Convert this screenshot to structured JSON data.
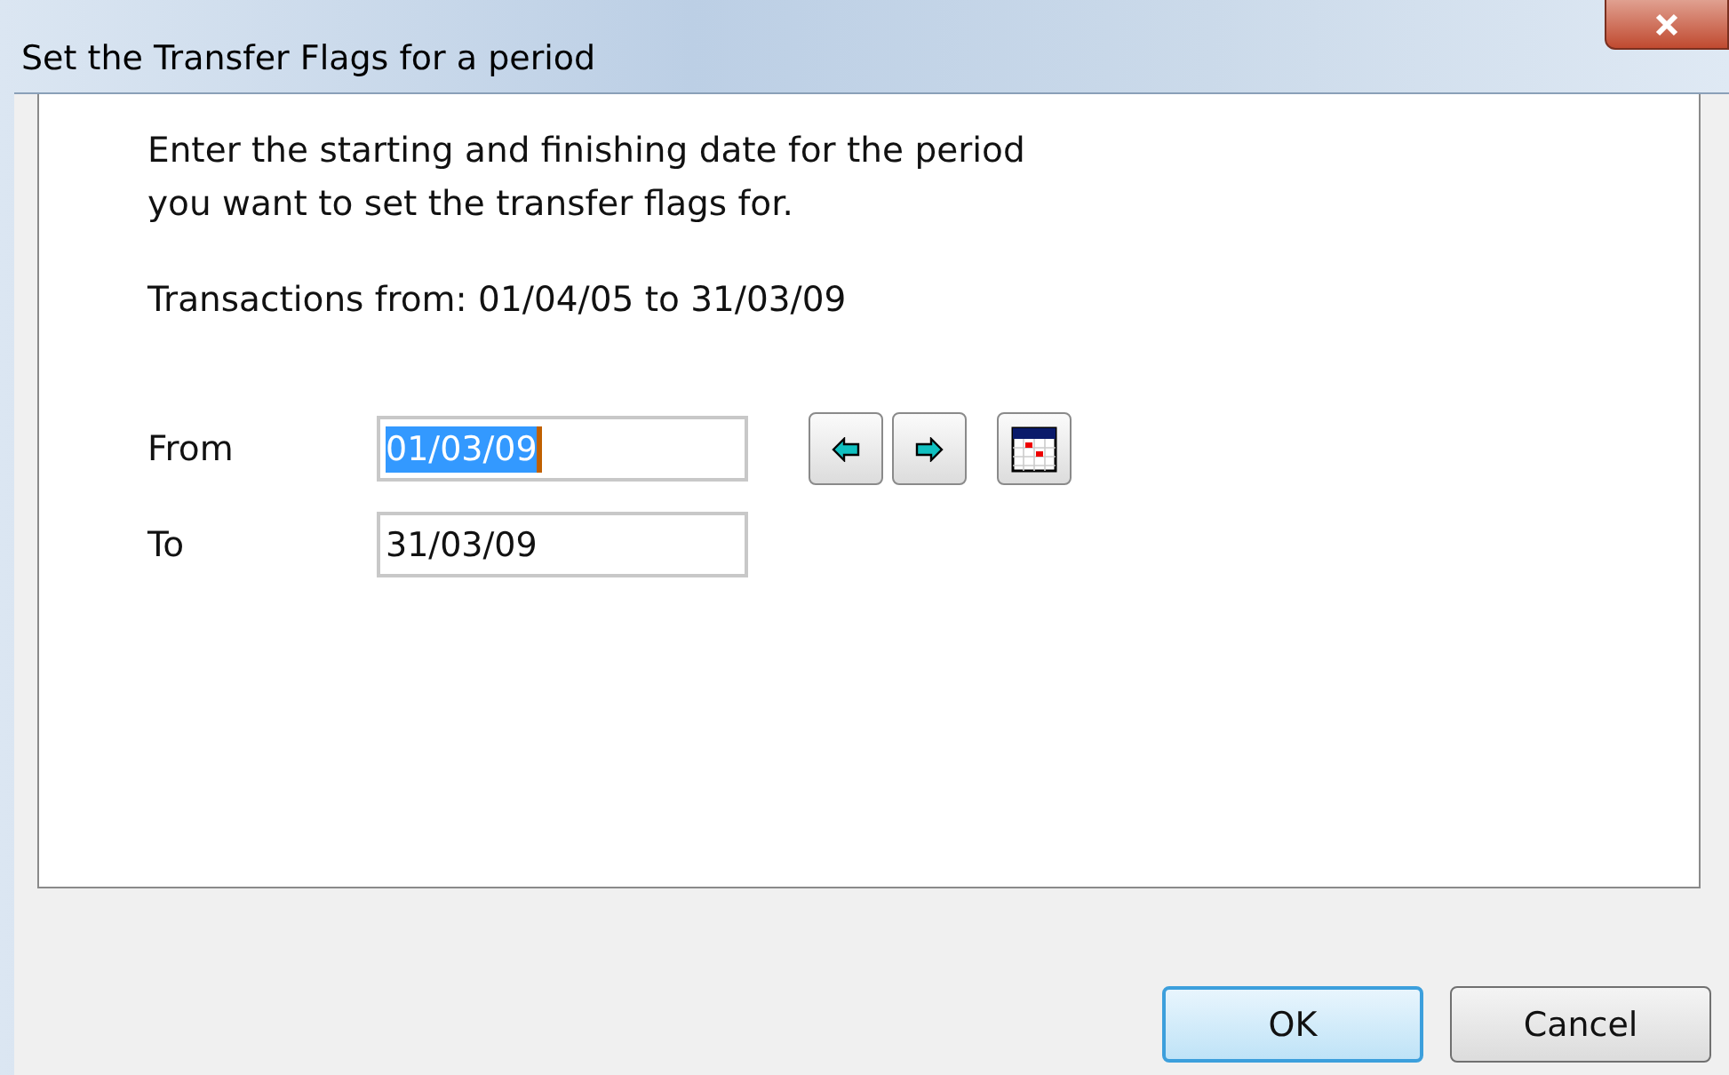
{
  "window": {
    "title": "Set the Transfer Flags for a period"
  },
  "intro": "Enter the starting and finishing date for the period\nyou want to set the transfer flags for.",
  "range": "Transactions from: 01/04/05 to 31/03/09",
  "fields": [
    {
      "label": "From",
      "value": "01/03/09",
      "text_selected": true
    },
    {
      "label": "To",
      "value": "31/03/09",
      "text_selected": false
    }
  ],
  "buttons": [
    {
      "label": "OK",
      "default": true
    },
    {
      "label": "Cancel",
      "default": false
    }
  ]
}
